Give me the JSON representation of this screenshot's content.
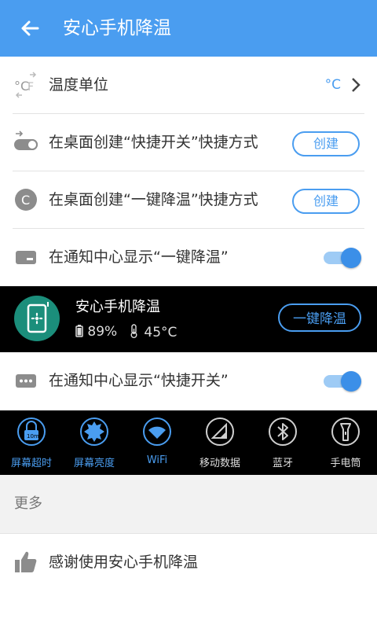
{
  "appbar": {
    "title": "安心手机降温",
    "back_icon": "arrow-left-icon"
  },
  "rows": {
    "temp_unit": {
      "label": "温度单位",
      "value": "°C",
      "icon": "celsius-fahrenheit-icon"
    },
    "shortcut_switch": {
      "label": "在桌面创建“快捷开关”快捷方式",
      "button": "创建",
      "icon": "toggle-shortcut-icon"
    },
    "shortcut_cool": {
      "label": "在桌面创建“一键降温”快捷方式",
      "button": "创建",
      "icon": "c-badge-icon"
    },
    "notify_cool": {
      "label": "在通知中心显示“一键降温”",
      "toggle": true,
      "icon": "card-icon"
    },
    "notify_switch": {
      "label": "在通知中心显示“快捷开关”",
      "toggle": true,
      "icon": "dots-icon"
    }
  },
  "notification": {
    "title": "安心手机降温",
    "battery": "89%",
    "temperature": "45°C",
    "button": "一键降温"
  },
  "switches": [
    {
      "label": "屏幕超时",
      "state": "on",
      "icon": "screen-timeout-icon",
      "badge": "10m"
    },
    {
      "label": "屏幕亮度",
      "state": "on",
      "icon": "brightness-icon"
    },
    {
      "label": "WiFi",
      "state": "on",
      "icon": "wifi-icon"
    },
    {
      "label": "移动数据",
      "state": "off",
      "icon": "mobile-data-icon"
    },
    {
      "label": "蓝牙",
      "state": "off",
      "icon": "bluetooth-icon"
    },
    {
      "label": "手电筒",
      "state": "off",
      "icon": "flashlight-icon"
    }
  ],
  "more": {
    "title": "更多"
  },
  "thanks": {
    "label": "感谢使用安心手机降温",
    "icon": "thumbs-up-icon"
  },
  "colors": {
    "accent": "#4a9df0",
    "appbar": "#4a9df0",
    "notif_icon": "#1b8e7b"
  }
}
